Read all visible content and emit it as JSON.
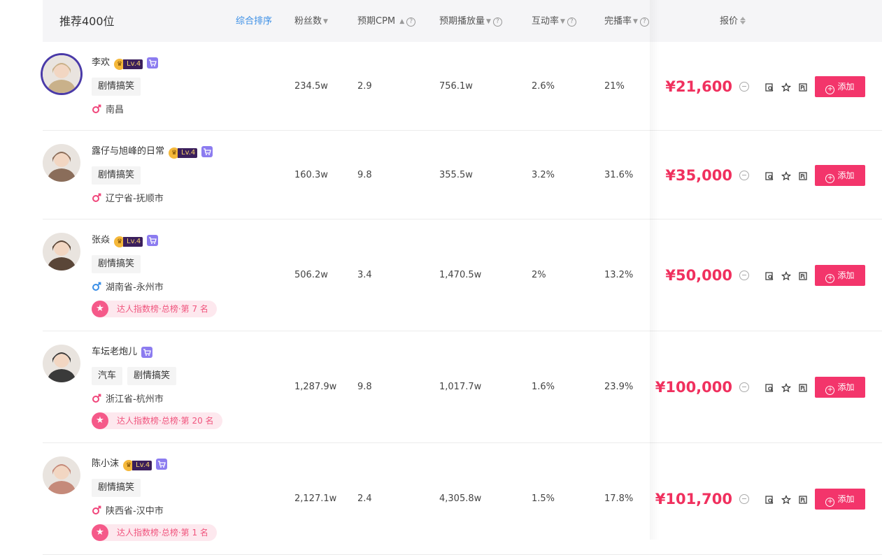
{
  "header": {
    "title": "推荐400位",
    "sort_default": "综合排序",
    "fans": "粉丝数",
    "cpm": "预期CPM",
    "plays": "预期播放量",
    "interaction": "互动率",
    "completion": "完播率",
    "price": "报价",
    "help_mark": "?",
    "arrow_down": "▼",
    "arrow_up": "▲"
  },
  "actions": {
    "add_label": "添加"
  },
  "level_label": "Lv.4",
  "rows": [
    {
      "name": "李欢",
      "has_level": true,
      "tags": [
        "剧情搞笑"
      ],
      "gender": "female",
      "location": "南昌",
      "rank": "",
      "fans": "234.5w",
      "cpm": "2.9",
      "plays": "756.1w",
      "interaction": "2.6%",
      "completion": "21%",
      "price": "¥21,600",
      "avatar_color": "#c9b18a"
    },
    {
      "name": "露仔与旭峰的日常",
      "has_level": true,
      "tags": [
        "剧情搞笑"
      ],
      "gender": "female",
      "location": "辽宁省-抚顺市",
      "rank": "",
      "fans": "160.3w",
      "cpm": "9.8",
      "plays": "355.5w",
      "interaction": "3.2%",
      "completion": "31.6%",
      "price": "¥35,000",
      "avatar_color": "#8a6d5a"
    },
    {
      "name": "张焱",
      "has_level": true,
      "tags": [
        "剧情搞笑"
      ],
      "gender": "male",
      "location": "湖南省-永州市",
      "rank": "达人指数榜·总榜·第 7 名",
      "fans": "506.2w",
      "cpm": "3.4",
      "plays": "1,470.5w",
      "interaction": "2%",
      "completion": "13.2%",
      "price": "¥50,000",
      "avatar_color": "#5a4638"
    },
    {
      "name": "车坛老炮儿",
      "has_level": false,
      "tags": [
        "汽车",
        "剧情搞笑"
      ],
      "gender": "female",
      "location": "浙江省-杭州市",
      "rank": "达人指数榜·总榜·第 20 名",
      "fans": "1,287.9w",
      "cpm": "9.8",
      "plays": "1,017.7w",
      "interaction": "1.6%",
      "completion": "23.9%",
      "price": "¥100,000",
      "avatar_color": "#3a3a3a"
    },
    {
      "name": "陈小沫",
      "has_level": true,
      "tags": [
        "剧情搞笑"
      ],
      "gender": "female",
      "location": "陕西省-汉中市",
      "rank": "达人指数榜·总榜·第 1 名",
      "fans": "2,127.1w",
      "cpm": "2.4",
      "plays": "4,305.8w",
      "interaction": "1.5%",
      "completion": "17.8%",
      "price": "¥101,700",
      "avatar_color": "#c58a7a"
    }
  ],
  "colors": {
    "accent": "#f3356b",
    "price": "#f0305e",
    "female": "#f0457a",
    "male": "#3a8ee6",
    "sort_link": "#3a8ee6"
  }
}
